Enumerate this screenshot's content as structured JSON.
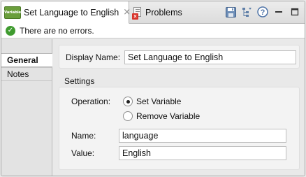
{
  "tabs": [
    {
      "icon_text": "Variable",
      "label": "Set Language to English",
      "close": "×",
      "active": true
    },
    {
      "label": "Problems",
      "active": false
    }
  ],
  "toolbar": {
    "icons": [
      "save-icon",
      "filter-tree-icon",
      "help-icon",
      "minimize-icon",
      "maximize-icon"
    ],
    "help_glyph": "?"
  },
  "status": {
    "icon": "check-icon",
    "glyph": "✓",
    "text": "There are no errors."
  },
  "sidebar": {
    "items": [
      {
        "label": "General",
        "active": true
      },
      {
        "label": "Notes",
        "active": false
      }
    ]
  },
  "general": {
    "display_name_label": "Display Name:",
    "display_name_value": "Set Language to English"
  },
  "settings": {
    "section_title": "Settings",
    "operation_label": "Operation:",
    "options": [
      {
        "label": "Set Variable",
        "selected": true
      },
      {
        "label": "Remove Variable",
        "selected": false
      }
    ],
    "name_label": "Name:",
    "name_value": "language",
    "value_label": "Value:",
    "value_value": "English"
  }
}
